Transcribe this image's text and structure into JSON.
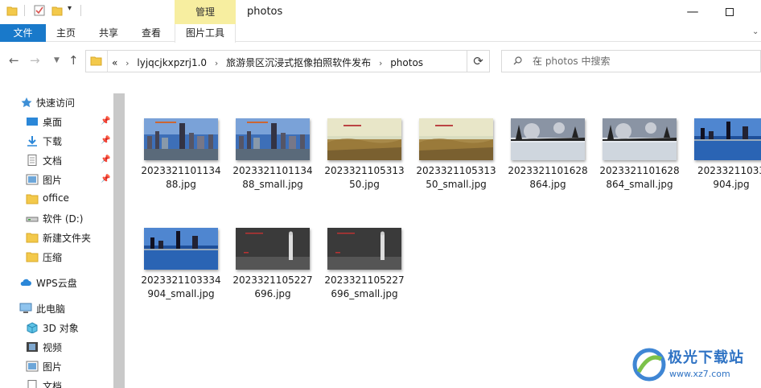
{
  "window": {
    "title": "photos",
    "contextual_tab_group": "管理"
  },
  "ribbon": {
    "tabs": [
      {
        "label": "文件"
      },
      {
        "label": "主页"
      },
      {
        "label": "共享"
      },
      {
        "label": "查看"
      },
      {
        "label": "图片工具"
      }
    ]
  },
  "address": {
    "prefix": "«",
    "crumbs": [
      "lyjqcjkxpzrj1.0",
      "旅游景区沉浸式抠像拍照软件发布",
      "photos"
    ]
  },
  "search": {
    "placeholder": "在 photos 中搜索"
  },
  "sidebar": {
    "items": [
      {
        "label": "快速访问",
        "icon": "star-icon"
      },
      {
        "label": "桌面",
        "icon": "desktop-icon",
        "pinned": true
      },
      {
        "label": "下载",
        "icon": "download-icon",
        "pinned": true
      },
      {
        "label": "文档",
        "icon": "document-icon",
        "pinned": true
      },
      {
        "label": "图片",
        "icon": "picture-icon",
        "pinned": true
      },
      {
        "label": "office",
        "icon": "folder-icon"
      },
      {
        "label": "软件 (D:)",
        "icon": "drive-icon"
      },
      {
        "label": "新建文件夹",
        "icon": "folder-icon"
      },
      {
        "label": "压缩",
        "icon": "folder-icon"
      },
      {
        "label": "WPS云盘",
        "icon": "cloud-icon"
      },
      {
        "label": "此电脑",
        "icon": "computer-icon"
      },
      {
        "label": "3D 对象",
        "icon": "cube-icon"
      },
      {
        "label": "视频",
        "icon": "video-icon"
      },
      {
        "label": "图片",
        "icon": "picture-icon"
      },
      {
        "label": "文档",
        "icon": "document-icon"
      }
    ]
  },
  "files": [
    {
      "line1": "2023321101134",
      "line2": "88.jpg",
      "thumb": "city"
    },
    {
      "line1": "2023321101134",
      "line2": "88_small.jpg",
      "thumb": "city"
    },
    {
      "line1": "2023321105313",
      "line2": "50.jpg",
      "thumb": "grass"
    },
    {
      "line1": "2023321105313",
      "line2": "50_small.jpg",
      "thumb": "grass"
    },
    {
      "line1": "2023321101628",
      "line2": "864.jpg",
      "thumb": "lake"
    },
    {
      "line1": "2023321101628",
      "line2": "864_small.jpg",
      "thumb": "lake"
    },
    {
      "line1": "20233211033",
      "line2": "904.jpg",
      "thumb": "bay"
    },
    {
      "line1": "2023321103334",
      "line2": "904_small.jpg",
      "thumb": "bay"
    },
    {
      "line1": "2023321105227",
      "line2": "696.jpg",
      "thumb": "studio"
    },
    {
      "line1": "2023321105227",
      "line2": "696_small.jpg",
      "thumb": "studio"
    }
  ],
  "watermark": {
    "title": "极光下载站",
    "url": "www.xz7.com"
  },
  "colors": {
    "accent": "#1979ca",
    "contextual_tab": "#f7eea0",
    "folder": "#f3c94b"
  }
}
